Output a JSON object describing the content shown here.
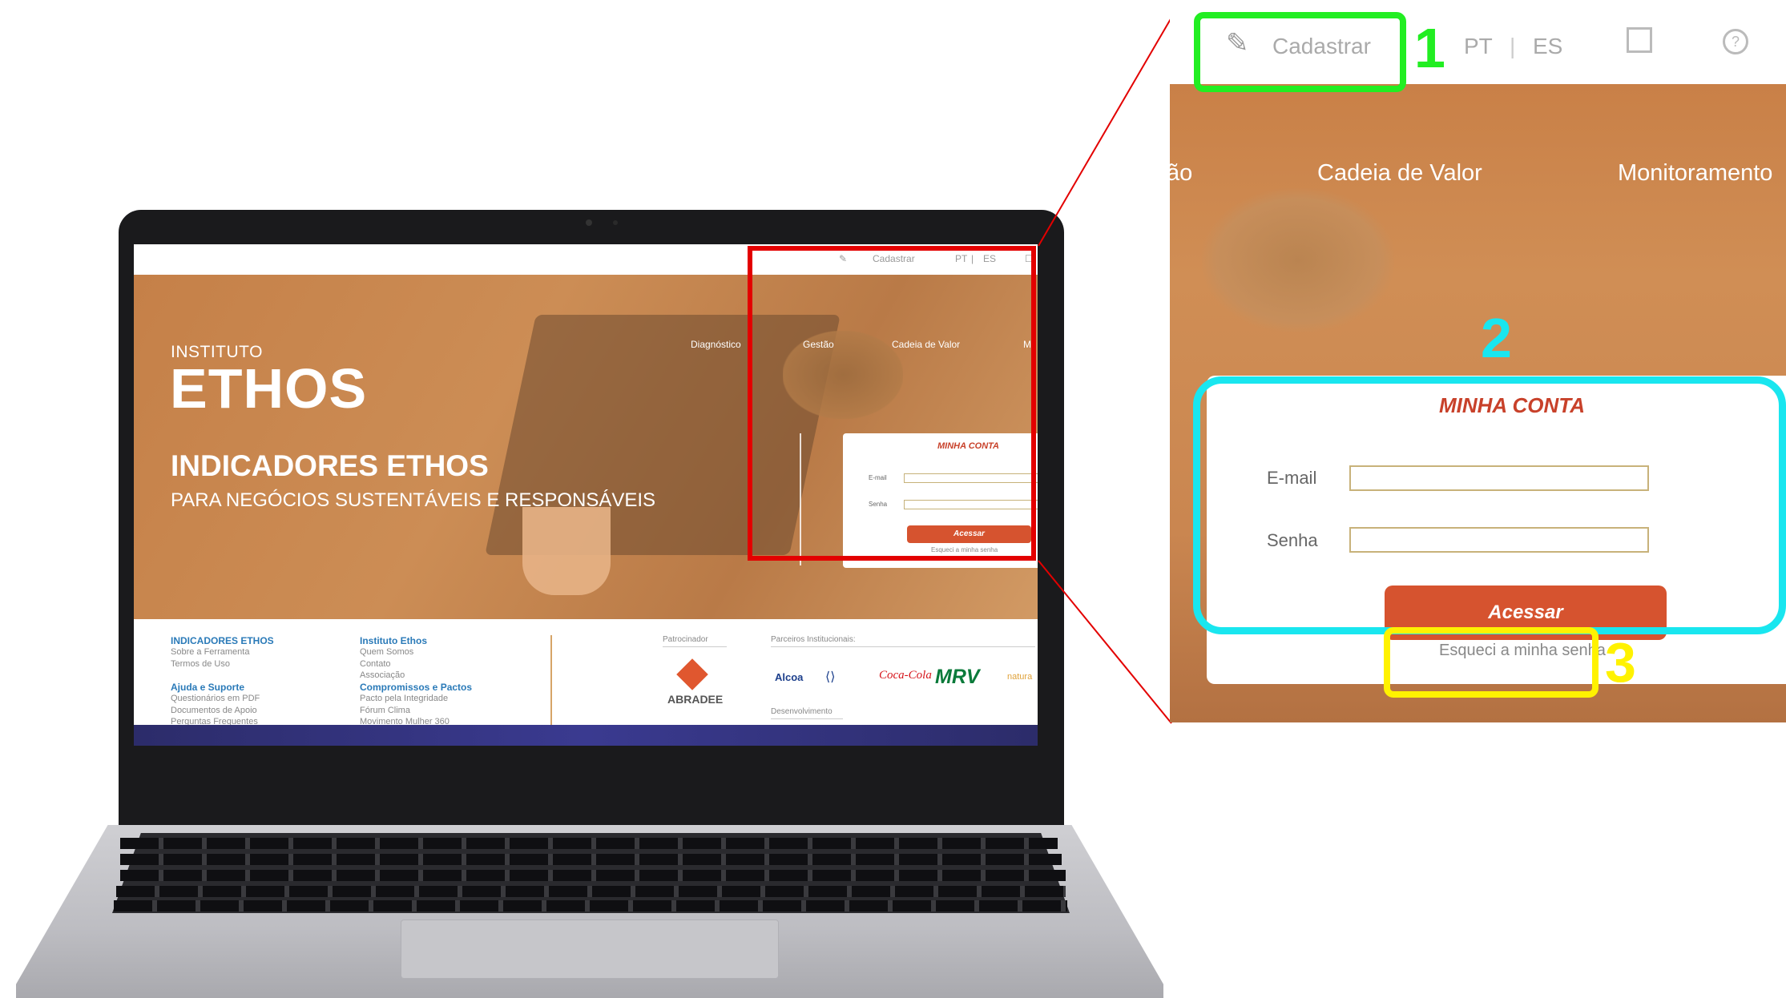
{
  "colors": {
    "highlight_1": "#22ee22",
    "highlight_2": "#19e6ef",
    "highlight_3": "#fff200",
    "zoom_frame": "#e30000",
    "brand_orange": "#d6532f"
  },
  "screen": {
    "topbar": {
      "cadastrar": "Cadastrar",
      "lang_pt": "PT",
      "sep": "|",
      "lang_es": "ES"
    },
    "logo": {
      "instituto": "INSTITUTO",
      "ethos": "ETHOS"
    },
    "hero": {
      "title": "INDICADORES ETHOS",
      "subtitle": "PARA NEGÓCIOS SUSTENTÁVEIS E RESPONSÁVEIS"
    },
    "nav": [
      "Diagnóstico",
      "Gestão",
      "Cadeia de Valor",
      "M"
    ],
    "login": {
      "title": "MINHA CONTA",
      "email_label": "E-mail",
      "senha_label": "Senha",
      "button": "Acessar",
      "forgot": "Esqueci a minha senha"
    },
    "footer": {
      "col1": {
        "head1": "INDICADORES ETHOS",
        "links1": [
          "Sobre a Ferramenta",
          "Termos de Uso"
        ],
        "head2": "Ajuda e Suporte",
        "links2": [
          "Questionários em PDF",
          "Documentos de Apoio",
          "Perguntas Frequentes"
        ]
      },
      "col2": {
        "head1": "Instituto Ethos",
        "links1": [
          "Quem Somos",
          "Contato",
          "Associação"
        ],
        "head2": "Compromissos e Pactos",
        "links2": [
          "Pacto pela Integridade",
          "Fórum Clima",
          "Movimento Mulher 360"
        ]
      },
      "patrocinador": "Patrocinador",
      "sponsor": "ABRADEE",
      "parceiros": "Parceiros Institucionais:",
      "partners": [
        "Alcoa",
        "Coca-Cola",
        "MRV",
        "natura"
      ],
      "desenvolvimento": "Desenvolvimento"
    }
  },
  "zoom": {
    "topbar": {
      "cadastrar": "Cadastrar",
      "lang_pt": "PT",
      "sep": "|",
      "lang_es": "ES"
    },
    "nav": [
      "ão",
      "Cadeia de Valor",
      "Monitoramento"
    ],
    "login": {
      "title": "MINHA CONTA",
      "email_label": "E-mail",
      "senha_label": "Senha",
      "button": "Acessar",
      "forgot": "Esqueci a minha senha"
    },
    "markers": [
      "1",
      "2",
      "3"
    ]
  }
}
